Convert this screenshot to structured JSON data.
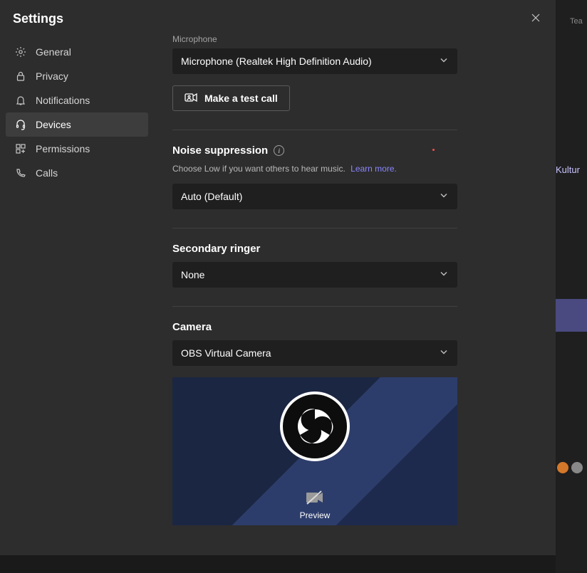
{
  "dialog": {
    "title": "Settings"
  },
  "sidebar": {
    "items": [
      {
        "label": "General"
      },
      {
        "label": "Privacy"
      },
      {
        "label": "Notifications"
      },
      {
        "label": "Devices"
      },
      {
        "label": "Permissions"
      },
      {
        "label": "Calls"
      }
    ],
    "active_index": 3
  },
  "devices": {
    "microphone": {
      "label": "Microphone",
      "value": "Microphone (Realtek High Definition Audio)"
    },
    "test_call_label": "Make a test call",
    "noise_suppression": {
      "title": "Noise suppression",
      "helper": "Choose Low if you want others to hear music.",
      "learn_more": "Learn more.",
      "value": "Auto (Default)"
    },
    "secondary_ringer": {
      "title": "Secondary ringer",
      "value": "None"
    },
    "camera": {
      "title": "Camera",
      "value": "OBS Virtual Camera",
      "preview_label": "Preview"
    }
  },
  "backdrop": {
    "tea": "Tea",
    "kultur": "Kultur"
  }
}
